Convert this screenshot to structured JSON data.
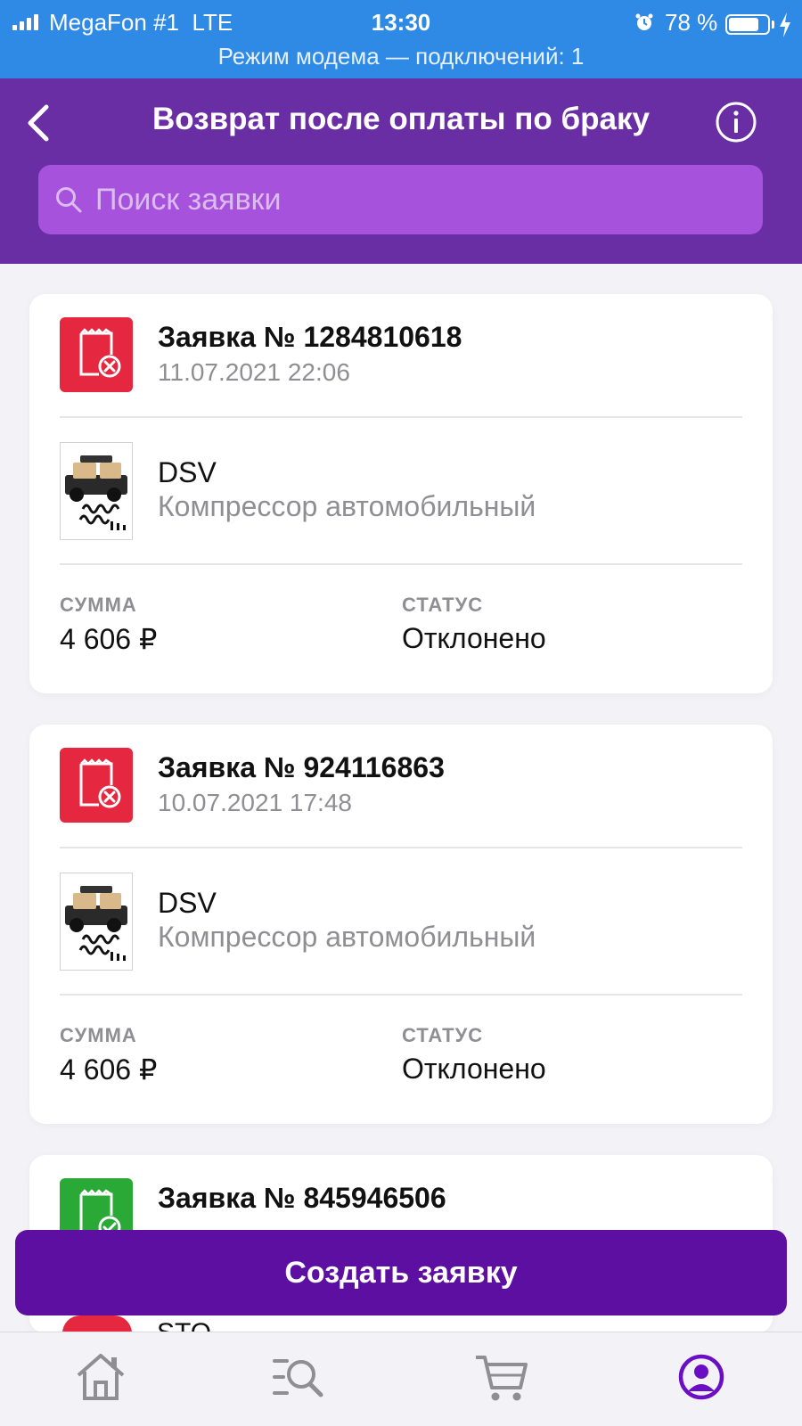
{
  "status_bar": {
    "carrier": "MegaFon #1",
    "network": "LTE",
    "time": "13:30",
    "battery": "78 %",
    "battery_level": 0.78,
    "hotspot_text": "Режим модема — подключений: 1"
  },
  "header": {
    "title": "Возврат после оплаты по браку",
    "back_icon": "chevron-left-icon",
    "info_icon": "info-circle-icon"
  },
  "search": {
    "placeholder": "Поиск заявки"
  },
  "labels": {
    "sum": "СУММА",
    "status": "СТАТУС"
  },
  "requests": [
    {
      "title": "Заявка № 1284810618",
      "date": "11.07.2021 22:06",
      "brand": "DSV",
      "product": "Компрессор автомобильный",
      "sum": "4 606 ₽",
      "status": "Отклонено",
      "state_color": "#e5273f",
      "state_icon": "receipt-rejected-icon"
    },
    {
      "title": "Заявка № 924116863",
      "date": "10.07.2021 17:48",
      "brand": "DSV",
      "product": "Компрессор автомобильный",
      "sum": "4 606 ₽",
      "status": "Отклонено",
      "state_color": "#e5273f",
      "state_icon": "receipt-rejected-icon"
    },
    {
      "title": "Заявка № 845946506",
      "state_color": "#2aa936",
      "state_icon": "receipt-approved-icon"
    }
  ],
  "peek_text": "STO",
  "create_button": "Создать заявку",
  "tabs": [
    {
      "icon": "home-icon",
      "active": false
    },
    {
      "icon": "catalog-search-icon",
      "active": false
    },
    {
      "icon": "cart-icon",
      "active": false
    },
    {
      "icon": "profile-icon",
      "active": true
    }
  ],
  "colors": {
    "status_bar": "#2f8ae6",
    "header": "#6a2ea4",
    "search_bg": "#a752dd",
    "button": "#5c0fa0",
    "tab_active": "#6b0fc4",
    "tab_inactive": "#8e8e93"
  }
}
